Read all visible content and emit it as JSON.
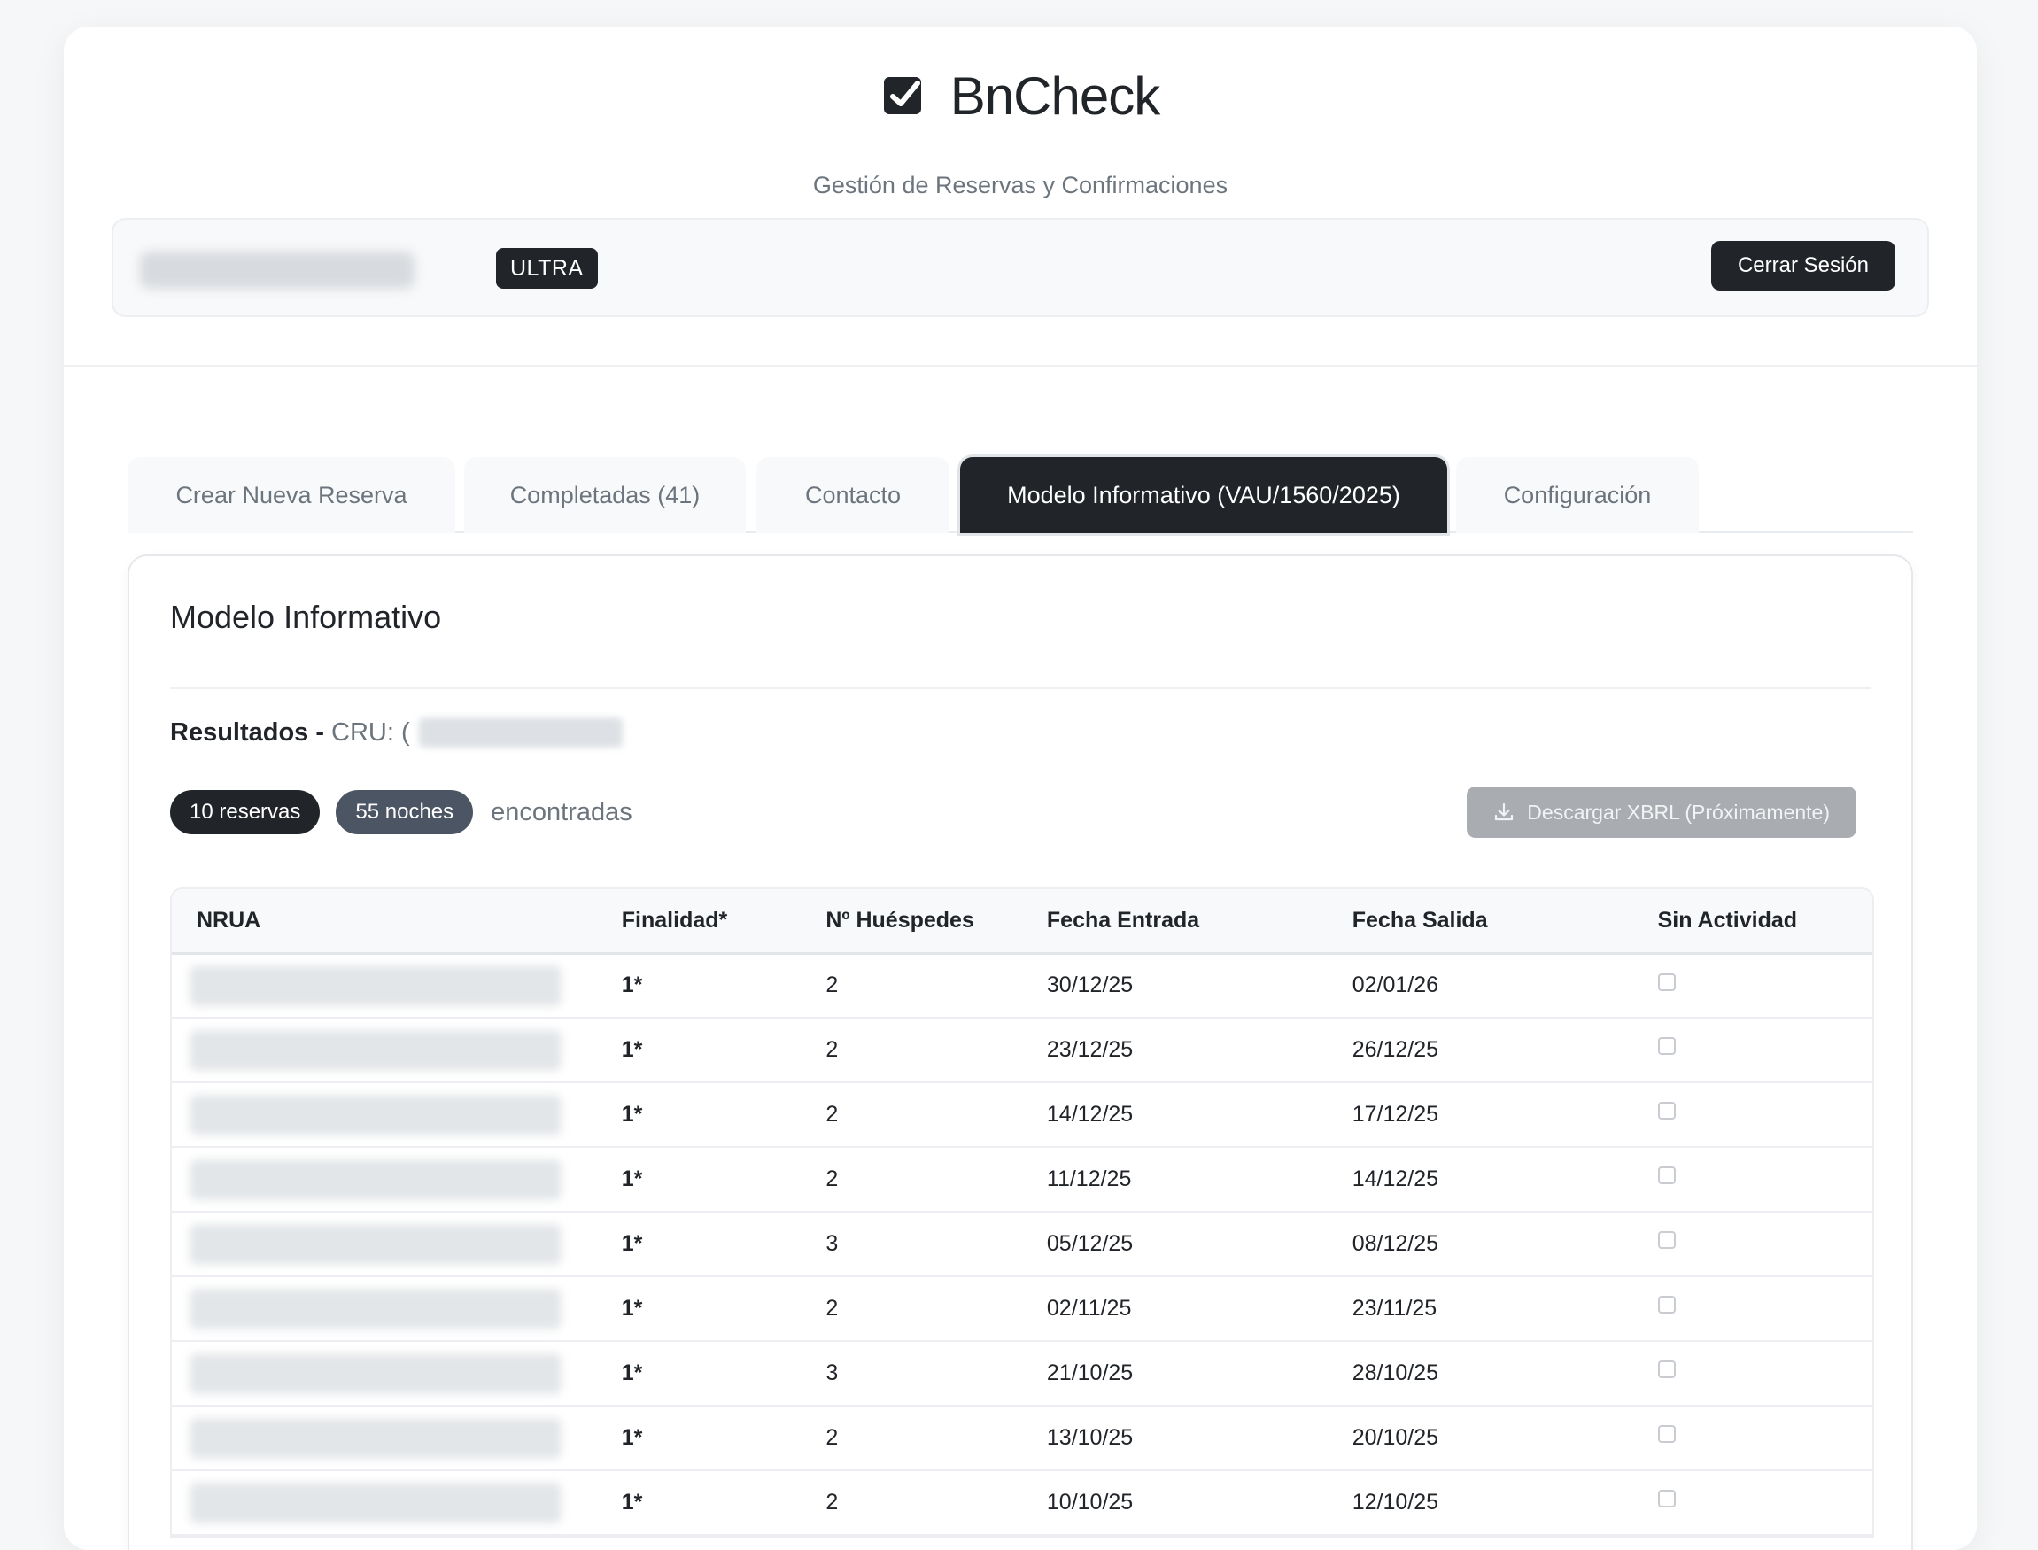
{
  "app": {
    "title": "BnCheck",
    "subtitle": "Gestión de Reservas y Confirmaciones"
  },
  "user": {
    "plan_badge": "ULTRA",
    "logout_label": "Cerrar Sesión"
  },
  "tabs": [
    {
      "label": "Crear Nueva Reserva",
      "active": false
    },
    {
      "label": "Completadas (41)",
      "active": false
    },
    {
      "label": "Contacto",
      "active": false
    },
    {
      "label": "Modelo Informativo (VAU/1560/2025)",
      "active": true
    },
    {
      "label": "Configuración",
      "active": false
    }
  ],
  "card": {
    "title": "Modelo Informativo",
    "results_label": "Resultados",
    "results_separator": "-",
    "cru_label": "CRU: (",
    "reservas_pill": "10 reservas",
    "noches_pill": "55 noches",
    "found_text": "encontradas",
    "download_label": "Descargar XBRL (Próximamente)"
  },
  "table": {
    "headers": [
      "NRUA",
      "Finalidad*",
      "Nº Huéspedes",
      "Fecha Entrada",
      "Fecha Salida",
      "Sin Actividad"
    ],
    "rows": [
      {
        "finalidad": "1*",
        "huespedes": "2",
        "entrada": "30/12/25",
        "salida": "02/01/26"
      },
      {
        "finalidad": "1*",
        "huespedes": "2",
        "entrada": "23/12/25",
        "salida": "26/12/25"
      },
      {
        "finalidad": "1*",
        "huespedes": "2",
        "entrada": "14/12/25",
        "salida": "17/12/25"
      },
      {
        "finalidad": "1*",
        "huespedes": "2",
        "entrada": "11/12/25",
        "salida": "14/12/25"
      },
      {
        "finalidad": "1*",
        "huespedes": "3",
        "entrada": "05/12/25",
        "salida": "08/12/25"
      },
      {
        "finalidad": "1*",
        "huespedes": "2",
        "entrada": "02/11/25",
        "salida": "23/11/25"
      },
      {
        "finalidad": "1*",
        "huespedes": "3",
        "entrada": "21/10/25",
        "salida": "28/10/25"
      },
      {
        "finalidad": "1*",
        "huespedes": "2",
        "entrada": "13/10/25",
        "salida": "20/10/25"
      },
      {
        "finalidad": "1*",
        "huespedes": "2",
        "entrada": "10/10/25",
        "salida": "12/10/25"
      }
    ]
  }
}
